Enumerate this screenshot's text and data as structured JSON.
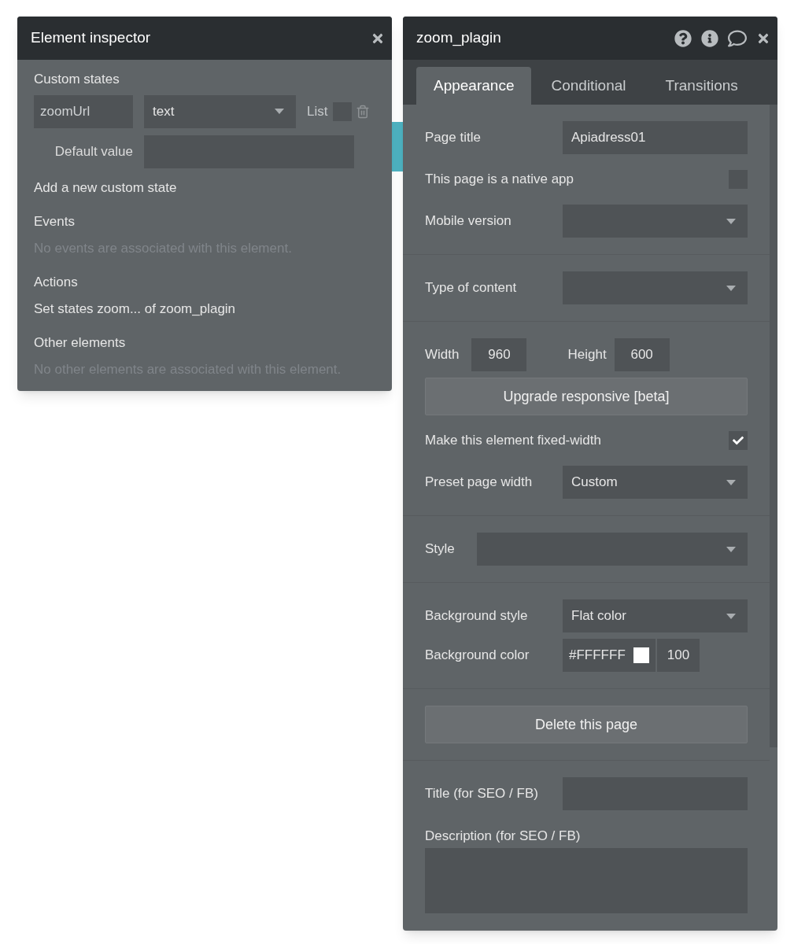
{
  "inspector": {
    "title": "Element inspector",
    "custom_states": {
      "heading": "Custom states",
      "name": "zoomUrl",
      "type": "text",
      "list_label": "List",
      "list_checked": false,
      "default_label": "Default value",
      "add_link": "Add a new custom state"
    },
    "sections": [
      {
        "heading": "Events",
        "items": [
          {
            "text": "No events are associated with this element.",
            "kind": "empty"
          }
        ]
      },
      {
        "heading": "Actions",
        "items": [
          {
            "text": "Set states zoom... of zoom_plagin",
            "kind": "link"
          }
        ]
      },
      {
        "heading": "Other elements",
        "items": [
          {
            "text": "No other elements are associated with this element.",
            "kind": "empty"
          }
        ]
      }
    ]
  },
  "editor": {
    "title": "zoom_plagin",
    "tabs": [
      {
        "label": "Appearance",
        "selected": true
      },
      {
        "label": "Conditional",
        "selected": false
      },
      {
        "label": "Transitions",
        "selected": false
      }
    ],
    "sections": [
      [
        {
          "kind": "field",
          "label": "Page title",
          "value": "Apiadress01"
        },
        {
          "kind": "checkbox",
          "label": "This page is a native app",
          "checked": false
        },
        {
          "kind": "dropdown",
          "label": "Mobile version"
        }
      ],
      [
        {
          "kind": "dropdown",
          "label": "Type of content"
        }
      ],
      [
        {
          "kind": "size",
          "label": "Width",
          "value": "960",
          "label2": "Height",
          "value2": "600"
        },
        {
          "kind": "button",
          "label": "Upgrade responsive [beta]"
        },
        {
          "kind": "checkbox",
          "label": "Make this element fixed-width",
          "checked": true
        },
        {
          "kind": "dropdown",
          "label": "Preset page width",
          "value": "Custom"
        }
      ],
      [
        {
          "kind": "wide_dropdown",
          "label": "Style"
        }
      ],
      [
        {
          "kind": "dropdown",
          "label": "Background style",
          "value": "Flat color"
        },
        {
          "kind": "color",
          "label": "Background color",
          "value": "#FFFFFF",
          "color": "#ffffff",
          "opacity": "100"
        }
      ],
      [
        {
          "kind": "button",
          "label": "Delete this page"
        }
      ],
      [
        {
          "kind": "field",
          "label": "Title (for SEO / FB)"
        },
        {
          "kind": "textarea",
          "label": "Description (for SEO / FB)"
        }
      ]
    ]
  }
}
